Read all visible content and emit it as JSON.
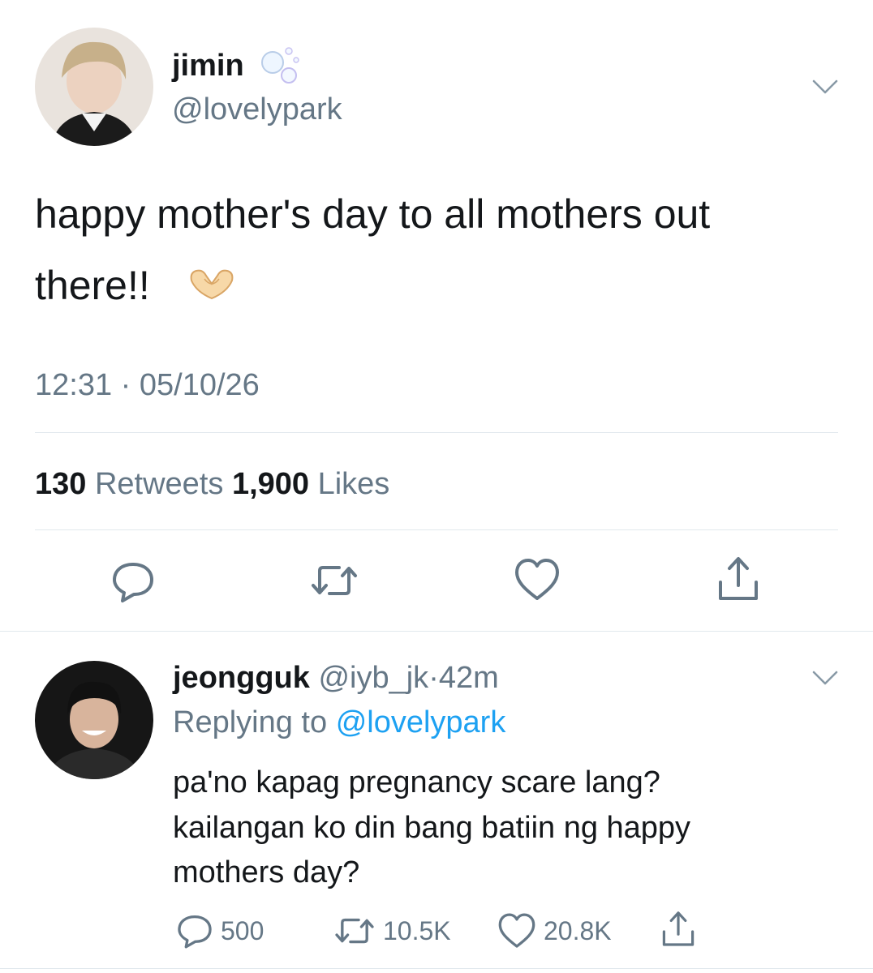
{
  "main_tweet": {
    "display_name": "jimin",
    "name_icon": "bubbles-emoji",
    "handle": "@lovelypark",
    "text_line1": "happy mother's day to all mothers out",
    "text_line2": "there!!",
    "text_emoji": "heart-hands-emoji",
    "time": "12:31",
    "dot": "·",
    "date": "05/10/26",
    "retweets_count": "130",
    "retweets_label": "Retweets",
    "likes_count": "1,900",
    "likes_label": "Likes"
  },
  "reply": {
    "display_name": "jeongguk",
    "handle": "@iyb_jk",
    "dot": "·",
    "age": "42m",
    "replying_prefix": "Replying to",
    "replying_handle": "@lovelypark",
    "text_line1": "pa'no kapag pregnancy scare lang?",
    "text_line2": "kailangan ko din bang batiin ng happy",
    "text_line3": "mothers day?",
    "replies_count": "500",
    "retweets_count": "10.5K",
    "likes_count": "20.8K"
  },
  "colors": {
    "text": "#14171a",
    "secondary": "#657786",
    "link": "#1da1f2",
    "divider": "#e1e8ed"
  }
}
